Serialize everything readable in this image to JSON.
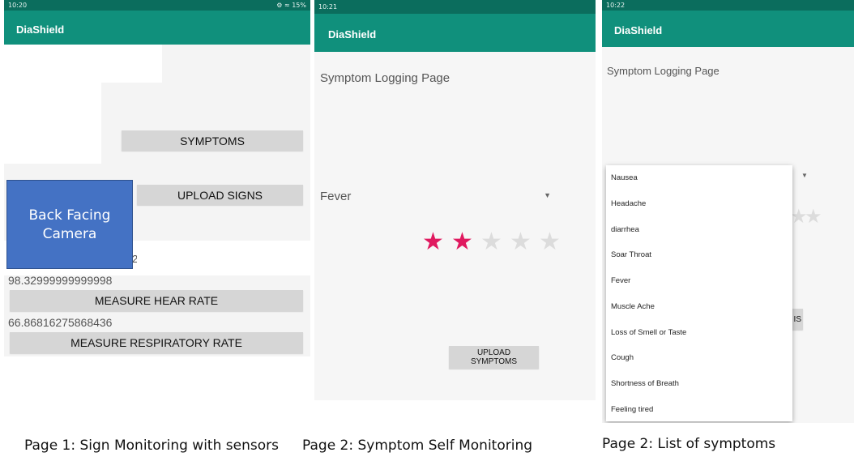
{
  "screens": [
    {
      "status": {
        "time": "10:20",
        "right": "⚙ ≈ 15%"
      },
      "app_title": "DiaShield",
      "symptoms_button": "SYMPTOMS",
      "upload_signs_button": "UPLOAD SIGNS",
      "camera_label_line1": "Back Facing",
      "camera_label_line2": "Camera",
      "heart_rate_value": "98.32999999999998",
      "measure_heart_button": "MEASURE HEAR RATE",
      "respiratory_value": "66.86816275868436",
      "measure_resp_button": "MEASURE RESPIRATORY RATE",
      "caption": "Page 1: Sign Monitoring with sensors"
    },
    {
      "status": {
        "time": "10:21"
      },
      "app_title": "DiaShield",
      "page_heading": "Symptom Logging Page",
      "selected_symptom": "Fever",
      "rating": {
        "value": 2,
        "max": 5
      },
      "upload_button": "UPLOAD SYMPTOMS",
      "caption": "Page 2: Symptom Self Monitoring"
    },
    {
      "status": {
        "time": "10:22"
      },
      "app_title": "DiaShield",
      "page_heading": "Symptom Logging Page",
      "partial_button_text": "IS",
      "dropdown_options": [
        "Nausea",
        "Headache",
        "diarrhea",
        "Soar Throat",
        "Fever",
        "Muscle Ache",
        "Loss of Smell or Taste",
        "Cough",
        "Shortness of Breath",
        "Feeling tired"
      ],
      "caption": "Page 2: List of symptoms"
    }
  ],
  "colors": {
    "appbar": "#10907c",
    "statusbar": "#0b6d5d",
    "camera": "#4472c4",
    "star_on": "#e0195f",
    "star_off": "#dcdcdc"
  },
  "icons": {
    "dropdown": "caret-down-icon",
    "star": "star-icon"
  }
}
